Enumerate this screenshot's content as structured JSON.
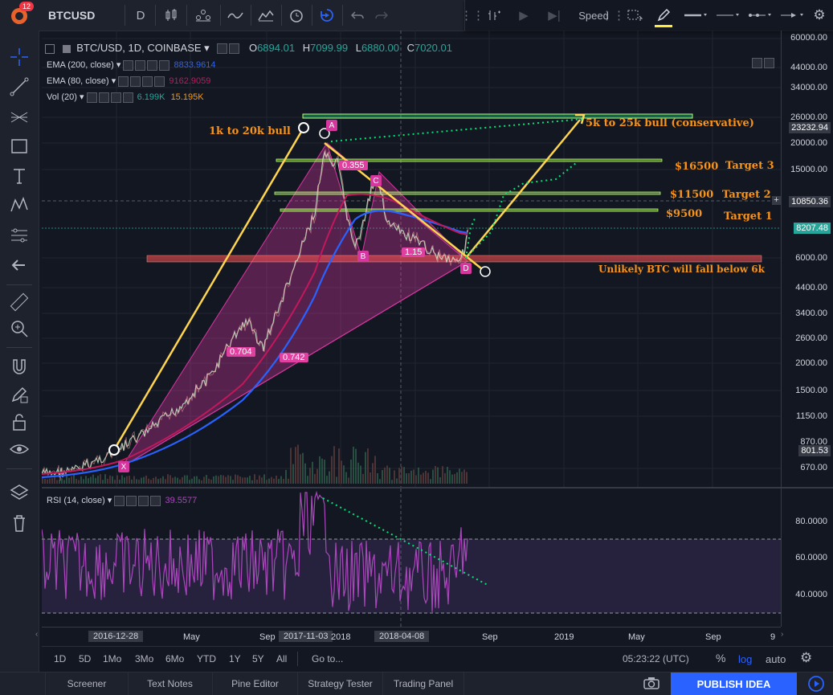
{
  "toolbar": {
    "notification_count": "12",
    "symbol": "BTCUSD",
    "interval": "D",
    "speed_label": "Speed"
  },
  "legend": {
    "title": "BTC/USD, 1D, COINBASE",
    "open_label": "O",
    "open": "6894.01",
    "high_label": "H",
    "high": "7099.99",
    "low_label": "L",
    "low": "6880.00",
    "close_label": "C",
    "close": "7020.01",
    "ema200_label": "EMA (200, close)",
    "ema200_value": "8833.9614",
    "ema80_label": "EMA (80, close)",
    "ema80_value": "9162.9059",
    "vol_label": "Vol (20)",
    "vol_value1": "6.199K",
    "vol_value2": "15.195K"
  },
  "rsi_legend": {
    "label": "RSI (14, close)",
    "value": "39.5577"
  },
  "annotations": {
    "bull1": "1k to 20k bull",
    "bull2": "5k to 25k bull (conservative)",
    "t3_price": "$16500",
    "t3_label": "Target 3",
    "t2_price": "$11500",
    "t2_label": "Target 2",
    "t1_price": "$9500",
    "t1_label": "Target 1",
    "support": "Unlikely BTC will fall below 6k",
    "pt_x": "X",
    "pt_a": "A",
    "pt_b": "B",
    "pt_c": "C",
    "pt_d": "D",
    "fib_0355": "0.355",
    "fib_115": "1.15",
    "fib_0704": "0.704",
    "fib_0742": "0.742"
  },
  "price_axis": {
    "ticks": [
      "60000.00",
      "44000.00",
      "34000.00",
      "26000.00",
      "20000.00",
      "15000.00",
      "10850.36",
      "8207.48",
      "6000.00",
      "4400.00",
      "3400.00",
      "2600.00",
      "2000.00",
      "1500.00",
      "1150.00",
      "870.00",
      "801.53",
      "670.00"
    ],
    "current_price": "23232.94",
    "crosshair_price": "10850.36",
    "ema_price": "8207.48",
    "vol_price": "801.53"
  },
  "rsi_axis": {
    "ticks": [
      "80.0000",
      "60.0000",
      "40.0000"
    ]
  },
  "time_axis": {
    "badge_left": "2016-12-28",
    "badge_mid": "2017-11-03",
    "badge_right": "2018-04-08",
    "ticks": [
      "May",
      "Sep",
      "2018",
      "Sep",
      "2019",
      "May",
      "Sep",
      "9"
    ]
  },
  "range_bar": {
    "buttons": [
      "1D",
      "5D",
      "1Mo",
      "3Mo",
      "6Mo",
      "YTD",
      "1Y",
      "5Y",
      "All"
    ],
    "goto": "Go to...",
    "time": "05:23:22 (UTC)",
    "pct": "%",
    "log": "log",
    "auto": "auto"
  },
  "bottom_tabs": [
    "Screener",
    "Text Notes",
    "Pine Editor",
    "Strategy Tester",
    "Trading Panel"
  ],
  "publish": "PUBLISH IDEA",
  "colors": {
    "bg": "#131722",
    "panel": "#1e222d",
    "accent": "#2962ff",
    "annotation": "#f7931a",
    "harmonic": "#d5379f",
    "target_line": "#b7ff6b",
    "support_band": "#ff5252",
    "ema200": "#2962ff",
    "ema80": "#c2185b",
    "rsi": "#9c27b0",
    "trend_arrow": "#ffd54f",
    "projection": "#00e676"
  }
}
